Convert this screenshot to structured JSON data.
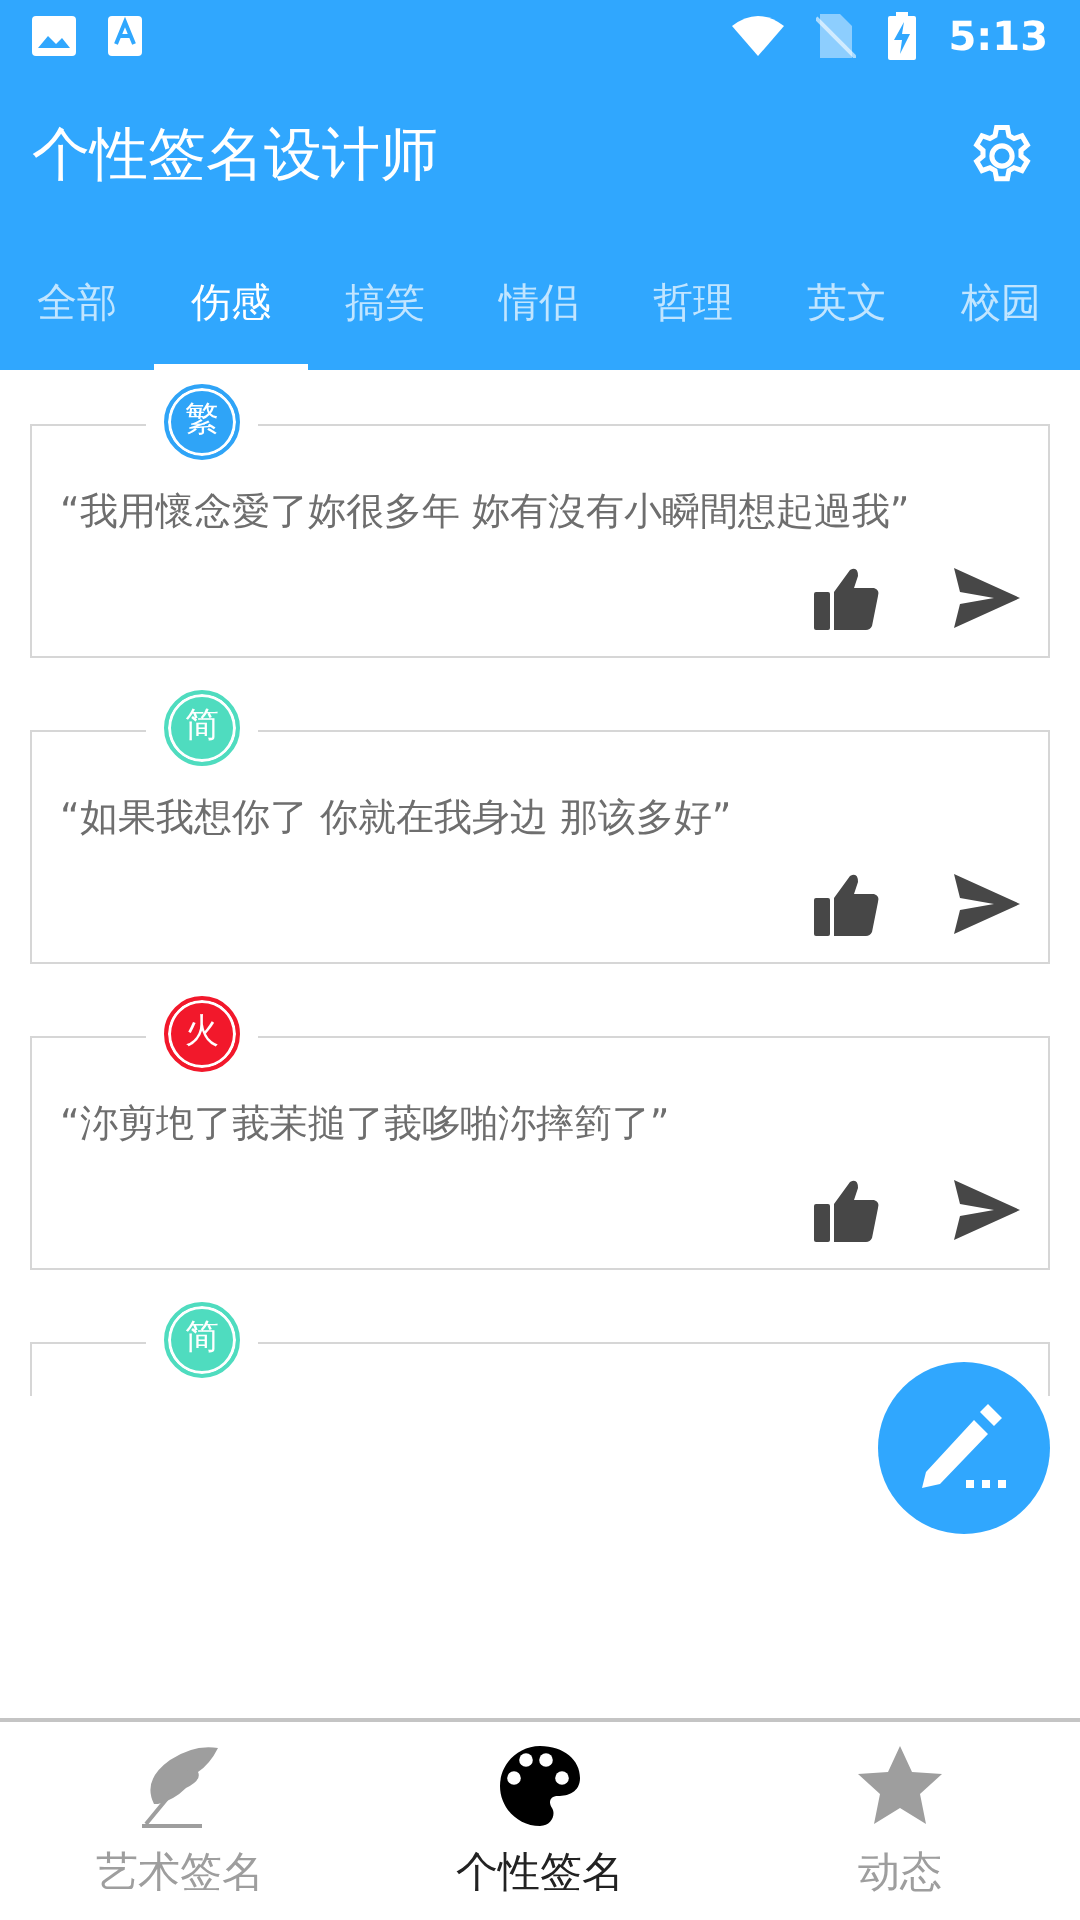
{
  "status_bar": {
    "time": "5:13"
  },
  "app_bar": {
    "title": "个性签名设计师"
  },
  "tabs": [
    {
      "label": "全部",
      "selected": false
    },
    {
      "label": "伤感",
      "selected": true
    },
    {
      "label": "搞笑",
      "selected": false
    },
    {
      "label": "情侣",
      "selected": false
    },
    {
      "label": "哲理",
      "selected": false
    },
    {
      "label": "英文",
      "selected": false
    },
    {
      "label": "校园",
      "selected": false
    }
  ],
  "cards": [
    {
      "badge": "繁",
      "color": "#2fa4f7",
      "quote": "“我用懷念愛了妳很多年 妳有沒有小瞬間想起過我”"
    },
    {
      "badge": "简",
      "color": "#4fdcbf",
      "quote": "“如果我想你了 你就在我身边 那该多好”"
    },
    {
      "badge": "火",
      "color": "#f2182b",
      "quote": "“沵剪垉了莪苿搥了莪哆啪沵摔箌了”"
    },
    {
      "badge": "简",
      "color": "#4fdcbf"
    }
  ],
  "bottom_nav": [
    {
      "label": "艺术签名",
      "selected": false
    },
    {
      "label": "个性签名",
      "selected": true
    },
    {
      "label": "动态",
      "selected": false
    }
  ]
}
